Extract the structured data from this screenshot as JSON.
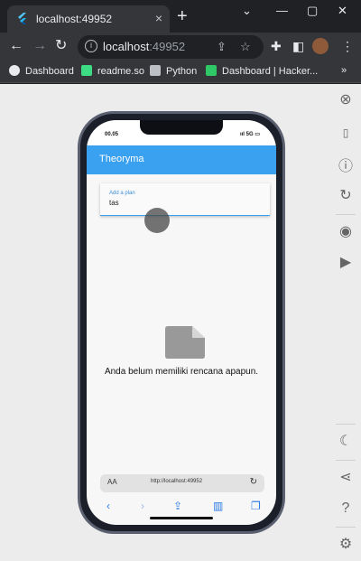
{
  "browser": {
    "tab_title": "localhost:49952",
    "tab_close": "×",
    "new_tab": "+",
    "window_controls": [
      "⌄",
      "—",
      "▢",
      "✕"
    ],
    "url_host": "localhost",
    "url_port": ":49952",
    "bookmarks": [
      {
        "label": "Dashboard",
        "color": "#e8eaed"
      },
      {
        "label": "readme.so",
        "color": "#3ddc84"
      },
      {
        "label": "Python",
        "color": "#bdc1c6"
      },
      {
        "label": "Dashboard | Hacker...",
        "color": "#2ec866"
      }
    ],
    "more_bookmarks": "»"
  },
  "app": {
    "title": "Theoryma",
    "input_label": "Add a plan",
    "input_value": "tas",
    "empty_message": "Anda belum memiliki rencana apapun.",
    "status_time": "00.05",
    "status_right": "5G"
  },
  "safari": {
    "aa": "AA",
    "url": "http://localhost:49952"
  },
  "colors": {
    "appbar": "#3aa0f0",
    "accent_label": "#3a8ed8"
  }
}
